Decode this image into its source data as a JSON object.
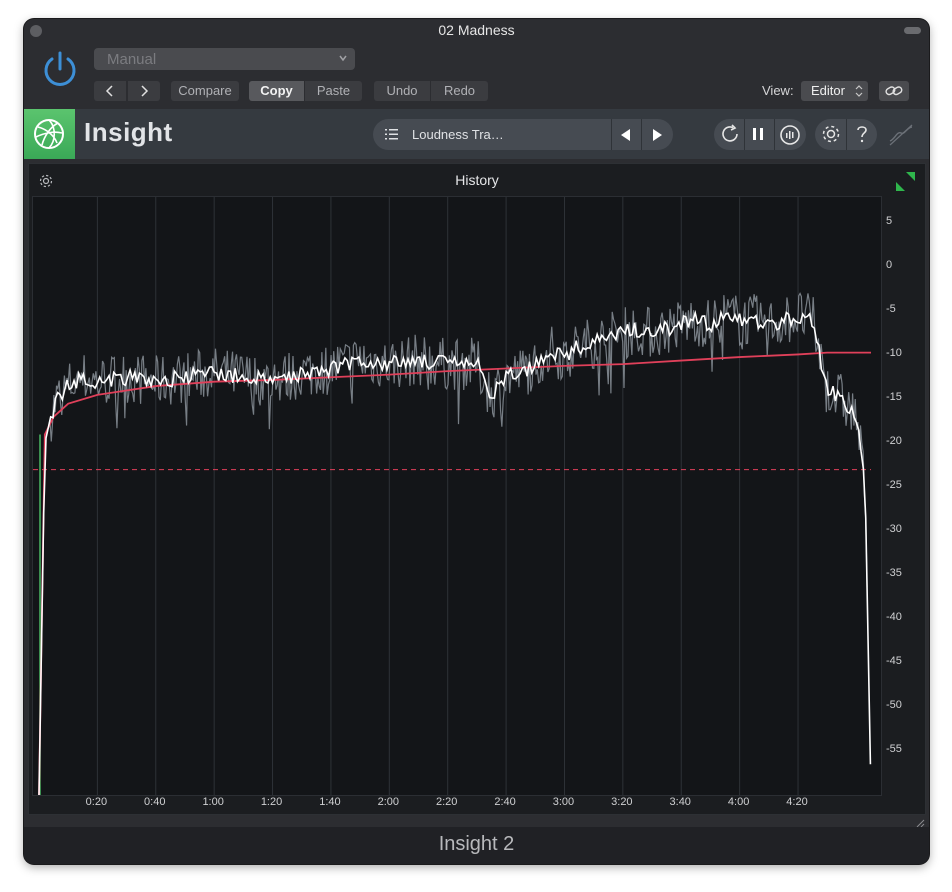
{
  "window": {
    "title": "02 Madness"
  },
  "host": {
    "preset": "Manual",
    "buttons": {
      "prev": "‹",
      "next": "›",
      "compare": "Compare",
      "copy": "Copy",
      "paste": "Paste",
      "undo": "Undo",
      "redo": "Redo"
    },
    "view_label": "View:",
    "view_value": "Editor"
  },
  "plugin": {
    "name": "Insight",
    "preset_name": "Loudness Tra…",
    "panel_title": "History",
    "footer": "Insight 2"
  },
  "colors": {
    "accent_green": "#4bb862",
    "momentary": "#8a9099",
    "short_term": "#ffffff",
    "integrated": "#e0405a",
    "target": "#e0405a"
  },
  "chart_data": {
    "type": "line",
    "title": "History",
    "xlabel": "",
    "ylabel": "",
    "x_unit": "m:ss",
    "xlim_seconds": [
      0,
      285
    ],
    "ylim": [
      -60,
      8
    ],
    "target_level": -23,
    "y_ticks": [
      "5",
      "0",
      "-5",
      "-10",
      "-15",
      "-20",
      "-25",
      "-30",
      "-35",
      "-40",
      "-45",
      "-50",
      "-55"
    ],
    "x_ticks": [
      "0:20",
      "0:40",
      "1:00",
      "1:20",
      "1:40",
      "2:00",
      "2:20",
      "2:40",
      "3:00",
      "3:20",
      "3:40",
      "4:00",
      "4:20"
    ],
    "series": [
      {
        "x": [
          0,
          1,
          2,
          4,
          6,
          8,
          10,
          15,
          20,
          30,
          40,
          50,
          60,
          70,
          80,
          90,
          100,
          110,
          120,
          130,
          140,
          150,
          155,
          160,
          165,
          170,
          175,
          180,
          185,
          190,
          195,
          200,
          205,
          210,
          215,
          220,
          225,
          230,
          235,
          240,
          245,
          250,
          255,
          260,
          265,
          270,
          275,
          280,
          283,
          285
        ],
        "y": [
          -60,
          -40,
          -20,
          -17,
          -15,
          -14.5,
          -13.5,
          -12.5,
          -13,
          -12.5,
          -13,
          -12.5,
          -12,
          -12.5,
          -13,
          -12,
          -11.5,
          -10.5,
          -11,
          -10.5,
          -11,
          -11,
          -14.5,
          -12.5,
          -12,
          -11,
          -9.5,
          -10,
          -9,
          -8.5,
          -8,
          -7.5,
          -7,
          -7.5,
          -7,
          -6.5,
          -6,
          -6.5,
          -5.5,
          -6,
          -6,
          -6.5,
          -6,
          -5.5,
          -6,
          -14,
          -15,
          -17,
          -25,
          -60
        ]
      },
      {
        "x": [
          0,
          2,
          5,
          10,
          20,
          40,
          60,
          80,
          100,
          120,
          140,
          160,
          180,
          200,
          220,
          240,
          260,
          270,
          280,
          285
        ],
        "y": [
          -60,
          -19,
          -17,
          -15.5,
          -14.5,
          -13.5,
          -13,
          -12.8,
          -12.5,
          -12.2,
          -11.8,
          -11.5,
          -11.2,
          -11,
          -10.6,
          -10.2,
          -9.9,
          -9.7,
          -9.7,
          -9.7
        ]
      }
    ]
  }
}
